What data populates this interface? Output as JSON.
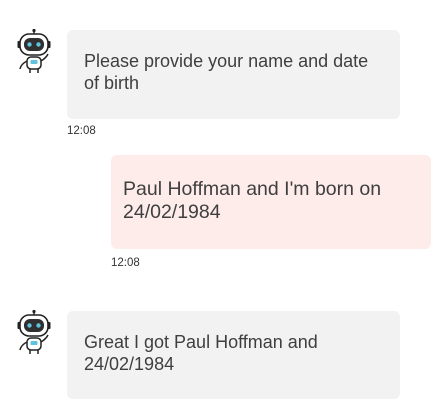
{
  "messages": [
    {
      "sender": "bot",
      "text": "Please provide your name and date of birth",
      "time": "12:08",
      "avatar_icon": "robot-icon"
    },
    {
      "sender": "user",
      "text": "Paul Hoffman and I'm born on 24/02/1984",
      "time": "12:08"
    },
    {
      "sender": "bot",
      "text": "Great I got Paul Hoffman and 24/02/1984",
      "avatar_icon": "robot-icon"
    }
  ],
  "colors": {
    "bot_bubble": "#f2f2f2",
    "user_bubble": "#fdecea",
    "text": "#3f3f3f"
  }
}
